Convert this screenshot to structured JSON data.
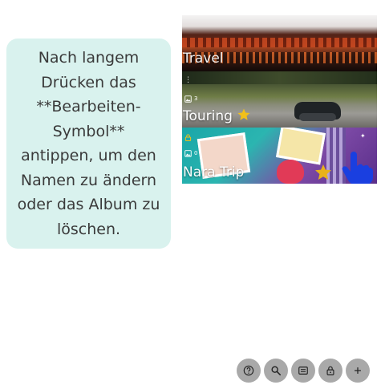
{
  "tip": {
    "text": "Nach langem Drücken das **Bearbeiten-Symbol** antippen, um den Namen zu ändern oder das Album zu löschen."
  },
  "albums": [
    {
      "title": "Travel",
      "count": "",
      "locked": false
    },
    {
      "title": "Touring",
      "count": "3",
      "locked": false
    },
    {
      "title": "Nara Trip",
      "count": "0",
      "locked": true
    }
  ],
  "toolbar": {
    "icons": [
      "help-icon",
      "search-icon",
      "list-icon",
      "lock-icon",
      "add-icon"
    ],
    "button_color": "#a9a9a9"
  },
  "colors": {
    "tip_background": "#d9f2ee",
    "hand_pointer": "#1a3fe0",
    "star": "#f2c01a"
  }
}
